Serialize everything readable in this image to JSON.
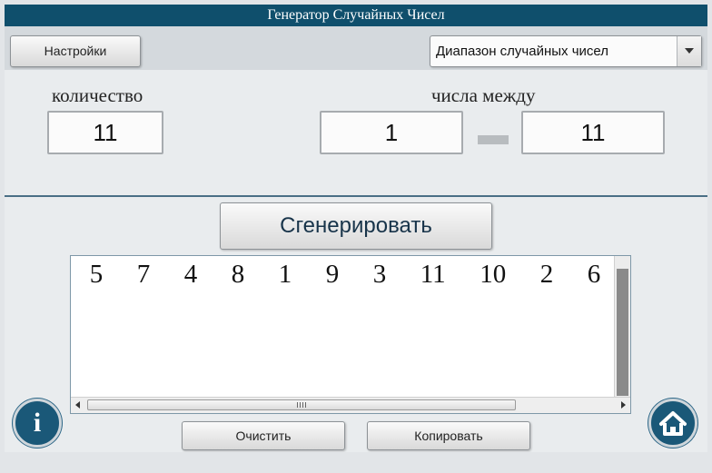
{
  "window": {
    "title": "Генератор Случайных Чисел"
  },
  "toolbar": {
    "settings_label": "Настройки",
    "mode_select": {
      "selected": "Диапазон случайных чисел"
    }
  },
  "count": {
    "label": "количество",
    "value": "11"
  },
  "range": {
    "label": "числа между",
    "min": "1",
    "max": "11"
  },
  "generate_label": "Сгенерировать",
  "output": {
    "numbers": [
      "5",
      "7",
      "4",
      "8",
      "1",
      "9",
      "3",
      "11",
      "10",
      "2",
      "6"
    ]
  },
  "footer": {
    "clear_label": "Очистить",
    "copy_label": "Копировать"
  },
  "icons": {
    "info": "info-icon",
    "home": "home-icon"
  },
  "colors": {
    "accent": "#0f4f6c",
    "round_button": "#1a5878"
  }
}
